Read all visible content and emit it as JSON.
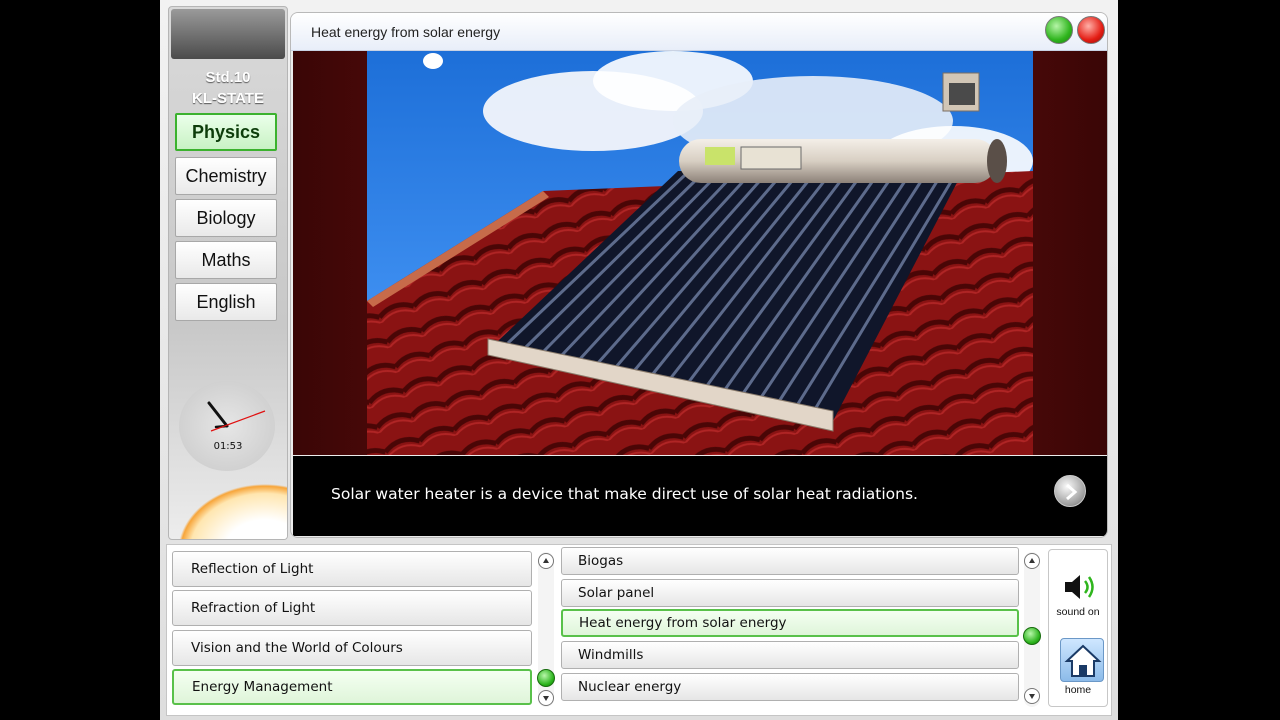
{
  "window": {
    "title": "Heat energy from solar energy"
  },
  "sidebar": {
    "std": "Std.10",
    "board": "KL-STATE",
    "subjects": [
      {
        "label": "Physics",
        "active": true
      },
      {
        "label": "Chemistry",
        "active": false
      },
      {
        "label": "Biology",
        "active": false
      },
      {
        "label": "Maths",
        "active": false
      },
      {
        "label": "English",
        "active": false
      }
    ],
    "clock_time": "01:53"
  },
  "player": {
    "caption": "Solar water heater is a device that make direct use of solar heat radiations."
  },
  "chapters": [
    {
      "label": "Reflection of Light",
      "active": false
    },
    {
      "label": "Refraction of Light",
      "active": false
    },
    {
      "label": "Vision and the World of Colours",
      "active": false
    },
    {
      "label": "Energy Management",
      "active": true
    }
  ],
  "topics": [
    {
      "label": "Biogas",
      "active": false
    },
    {
      "label": "Solar panel",
      "active": false
    },
    {
      "label": "Heat energy from solar energy",
      "active": true
    },
    {
      "label": "Windmills",
      "active": false
    },
    {
      "label": "Nuclear energy",
      "active": false
    }
  ],
  "controls": {
    "sound_label": "sound on",
    "home_label": "home"
  },
  "colors": {
    "accent_green": "#3bb22e",
    "close_red": "#e41d14",
    "caption_bg": "#000000"
  },
  "icons": {
    "sound": "speaker-icon",
    "home": "house-icon",
    "next": "chevron-right-icon"
  }
}
